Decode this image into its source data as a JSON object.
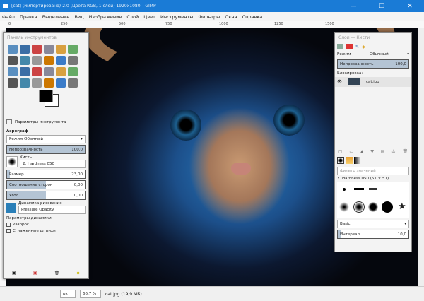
{
  "window": {
    "title": "[cat] (импортировано)-2.0 (Цвета RGB, 1 слой) 1920x1080 – GIMP",
    "min": "—",
    "max": "☐",
    "close": "✕"
  },
  "menu": [
    "Файл",
    "Правка",
    "Выделение",
    "Вид",
    "Изображение",
    "Слой",
    "Цвет",
    "Инструменты",
    "Фильтры",
    "Окна",
    "Справка"
  ],
  "ruler": [
    "0",
    "250",
    "500",
    "750",
    "1000",
    "1250",
    "1500"
  ],
  "toolbox": {
    "title": "Панель инструментов",
    "tab": "Параметры инструмента",
    "tool_name": "Аэрограф",
    "mode_label": "Режим",
    "mode_value": "Обычный",
    "opacity_label": "Непрозрачность",
    "opacity_value": "100,0",
    "opacity": 1.0,
    "brush_label": "Кисть",
    "brush_value": "2. Hardness 050",
    "size_label": "Размер",
    "size_value": "23,00",
    "aspect_label": "Соотношение сторон",
    "aspect_value": "0,00",
    "angle_label": "Угол",
    "angle_value": "0,00",
    "dynamics_label": "Динамика рисования",
    "dynamics_value": "Pressure Opacity",
    "dyn_params": "Параметры динамики",
    "jitter": "Разброс",
    "smooth": "Сглаженные штрихи"
  },
  "layers": {
    "title": "Слои — Кисти",
    "mode_label": "Режим",
    "mode_value": "Обычный",
    "opacity_label": "Непрозрачность",
    "opacity_value": "100,0",
    "lock_label": "Блокировка:",
    "layer_name": "cat.jpg"
  },
  "brushes": {
    "filter_placeholder": "фильтр значений",
    "brush_name": "2. Hardness 050 (51 × 51)",
    "preset": "Basic",
    "spacing_label": "Интервал",
    "spacing_value": "10,0"
  },
  "status": {
    "unit": "px",
    "zoom": "66,7 %",
    "file": "cat.jpg (19,9 МБ)"
  }
}
